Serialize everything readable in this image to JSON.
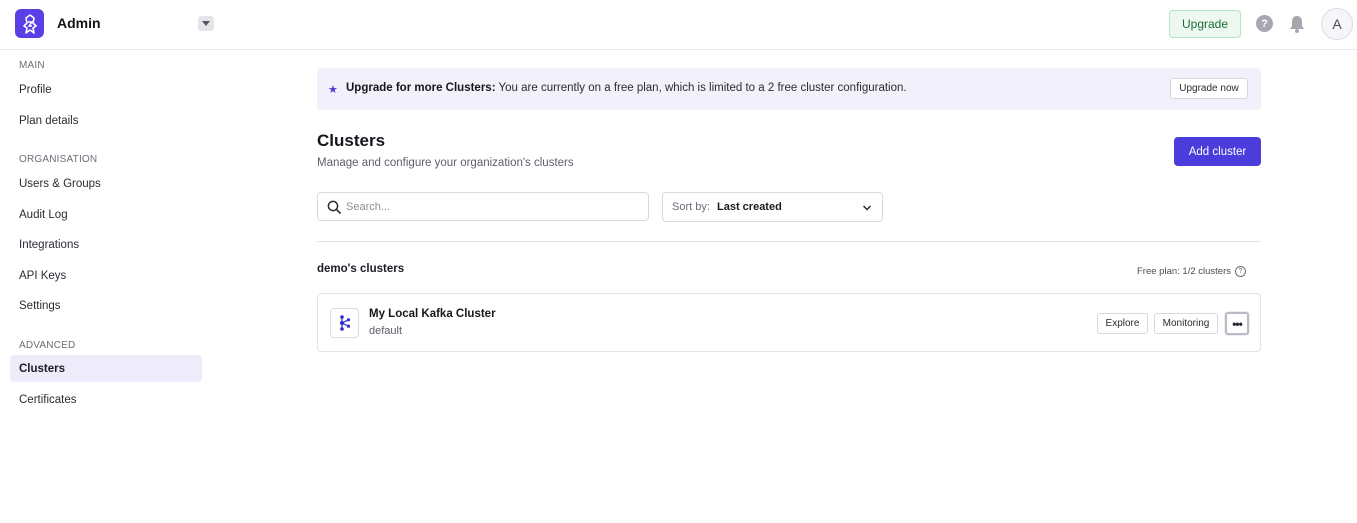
{
  "header": {
    "app_title": "Admin",
    "upgrade_label": "Upgrade",
    "help_glyph": "?",
    "avatar_initial": "A",
    "brand_color": "#5a3ee6"
  },
  "sidebar": {
    "sections": [
      {
        "label": "MAIN",
        "items": [
          "Profile",
          "Plan details"
        ]
      },
      {
        "label": "ORGANISATION",
        "items": [
          "Users & Groups",
          "Audit Log",
          "Integrations",
          "API Keys",
          "Settings"
        ]
      },
      {
        "label": "ADVANCED",
        "items": [
          "Clusters",
          "Certificates"
        ]
      }
    ],
    "active_item": "Clusters"
  },
  "banner": {
    "title": "Upgrade for more Clusters:",
    "message": "You are currently on a free plan, which is limited to a 2 free cluster configuration.",
    "button_label": "Upgrade now"
  },
  "page": {
    "title": "Clusters",
    "subtitle": "Manage and configure your organization's clusters",
    "add_button_label": "Add cluster"
  },
  "filters": {
    "search_placeholder": "Search...",
    "sort_label": "Sort by:",
    "sort_value": "Last created"
  },
  "group": {
    "title": "demo's clusters",
    "plan_info": "Free plan: 1/2 clusters"
  },
  "clusters": [
    {
      "name": "My Local Kafka Cluster",
      "environment": "default",
      "explore_label": "Explore",
      "monitoring_label": "Monitoring",
      "more_glyph": "•••"
    }
  ],
  "colors": {
    "primary_button": "#4a3ddb",
    "upgrade_bg": "#ecf8f0",
    "banner_bg": "#f1f0fb",
    "active_nav_bg": "#eeecfb"
  }
}
